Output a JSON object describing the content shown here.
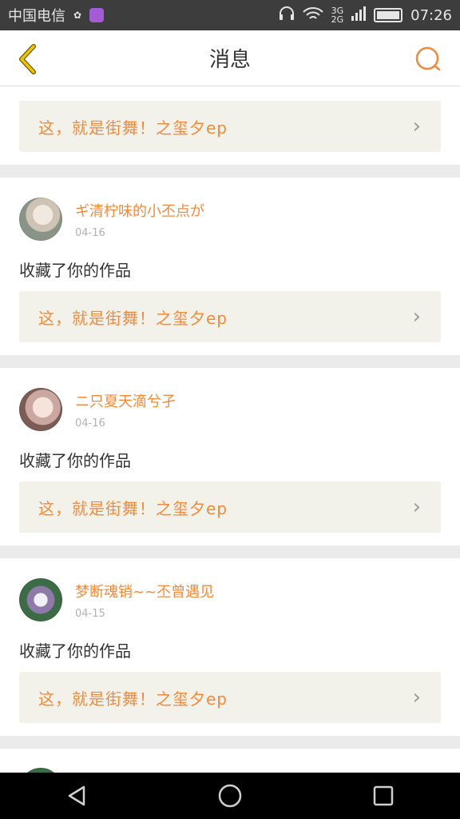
{
  "status_bar": {
    "carrier": "中国电信",
    "network_top": "3G",
    "network_bottom": "2G",
    "time": "07:26"
  },
  "header": {
    "title": "消息",
    "accent_color": "#f08a3c"
  },
  "work_title": "这，就是街舞！之玺夕ep",
  "top_card": {
    "work": "这，就是街舞！之玺夕ep"
  },
  "messages": [
    {
      "user": "ギ清柠味的小丕点が",
      "date": "04-16",
      "action": "收藏了你的作品",
      "work": "这，就是街舞！之玺夕ep"
    },
    {
      "user": "ニ只夏天滴兮孑",
      "date": "04-16",
      "action": "收藏了你的作品",
      "work": "这，就是街舞！之玺夕ep"
    },
    {
      "user": "梦断魂销~~丕曾遇见",
      "date": "04-15",
      "action": "收藏了你的作品",
      "work": "这，就是街舞！之玺夕ep"
    }
  ],
  "icons": {
    "back": "chevron-left-icon",
    "search": "search-icon",
    "nav_back": "triangle-back-icon",
    "nav_home": "circle-home-icon",
    "nav_recent": "square-recent-icon"
  }
}
